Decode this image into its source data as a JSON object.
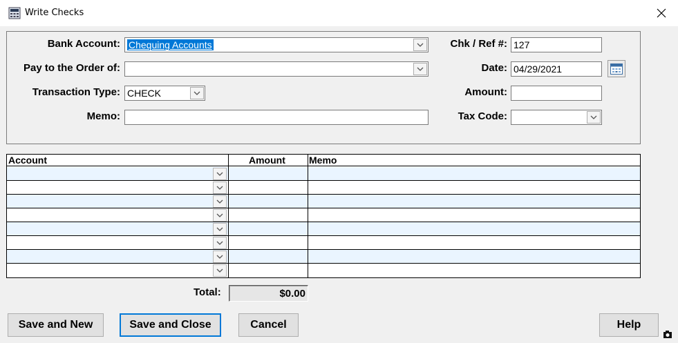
{
  "window": {
    "title": "Write Checks",
    "icons": {
      "app": "calculator-icon",
      "close": "close-icon"
    }
  },
  "form": {
    "bank_account_label": "Bank Account:",
    "bank_account_value": "Chequing Accounts",
    "pay_to_label": "Pay to the Order of:",
    "pay_to_value": "",
    "transaction_type_label": "Transaction Type:",
    "transaction_type_value": "CHECK",
    "memo_label": "Memo:",
    "memo_value": "",
    "chk_ref_label": "Chk / Ref #:",
    "chk_ref_value": "127",
    "date_label": "Date:",
    "date_value": "04/29/2021",
    "amount_label": "Amount:",
    "amount_value": "",
    "tax_code_label": "Tax Code:",
    "tax_code_value": ""
  },
  "grid": {
    "columns": [
      "Account",
      "Amount",
      "Memo"
    ],
    "rows": [
      {
        "account": "",
        "amount": "",
        "memo": ""
      },
      {
        "account": "",
        "amount": "",
        "memo": ""
      },
      {
        "account": "",
        "amount": "",
        "memo": ""
      },
      {
        "account": "",
        "amount": "",
        "memo": ""
      },
      {
        "account": "",
        "amount": "",
        "memo": ""
      },
      {
        "account": "",
        "amount": "",
        "memo": ""
      },
      {
        "account": "",
        "amount": "",
        "memo": ""
      },
      {
        "account": "",
        "amount": "",
        "memo": ""
      }
    ]
  },
  "totals": {
    "label": "Total:",
    "value": "$0.00"
  },
  "buttons": {
    "save_new": "Save and New",
    "save_close": "Save and Close",
    "cancel": "Cancel",
    "help": "Help"
  },
  "colors": {
    "selection": "#0078d7",
    "row_alt": "#eaf5ff",
    "panel_bg": "#f0f0f0"
  }
}
